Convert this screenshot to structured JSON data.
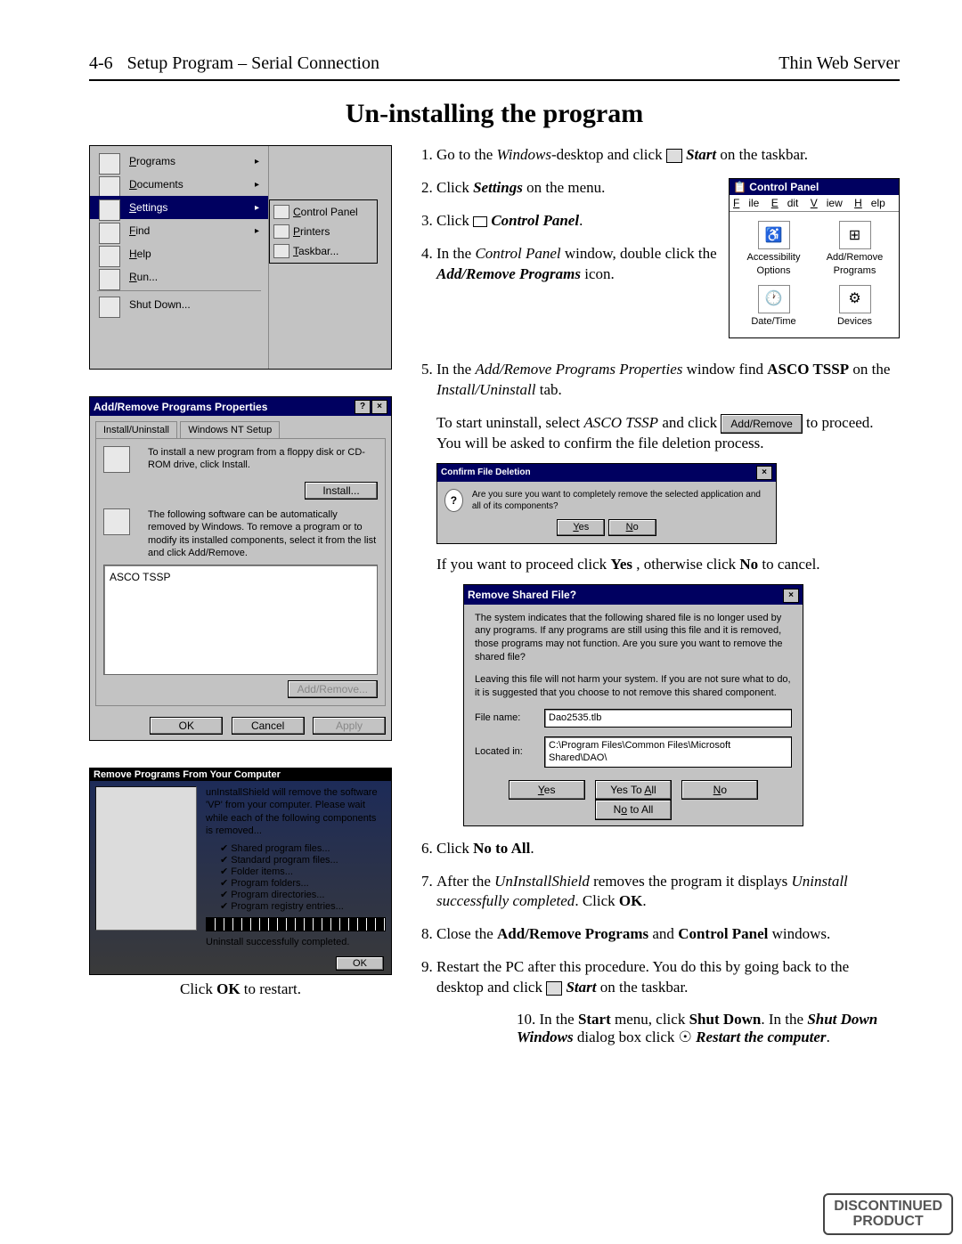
{
  "header": {
    "page_no": "4-6",
    "section": "Setup Program – Serial Connection",
    "doc": "Thin Web Server"
  },
  "title": "Un-installing the program",
  "startmenu": {
    "items": [
      "Programs",
      "Documents",
      "Settings",
      "Find",
      "Help",
      "Run...",
      "Shut Down..."
    ],
    "submenu": [
      "Control Panel",
      "Printers",
      "Taskbar..."
    ]
  },
  "addremove": {
    "title": "Add/Remove Programs Properties",
    "tab1": "Install/Uninstall",
    "tab2": "Windows NT Setup",
    "text1": "To install a new program from a floppy disk or CD-ROM drive, click Install.",
    "install_btn": "Install...",
    "text2": "The following software can be automatically removed by Windows. To remove a program or to modify its installed components, select it from the list and click Add/Remove.",
    "list_item": "ASCO TSSP",
    "addrem_btn": "Add/Remove...",
    "ok": "OK",
    "cancel": "Cancel",
    "apply": "Apply"
  },
  "unshield": {
    "title": "Remove Programs From Your Computer",
    "text": "unInstallShield will remove the software 'VP' from your computer. Please wait while each of the following components is removed...",
    "items": [
      "Shared program files...",
      "Standard program files...",
      "Folder items...",
      "Program folders...",
      "Program directories...",
      "Program registry entries..."
    ],
    "done": "Uninstall successfully completed.",
    "ok": "OK"
  },
  "foot_left": "Click OK to restart.",
  "cp": {
    "title": "Control Panel",
    "menu": [
      "File",
      "Edit",
      "View",
      "Help"
    ],
    "icons": [
      "Accessibility Options",
      "Add/Remove Programs",
      "Date/Time",
      "Devices"
    ]
  },
  "steps": {
    "s1a": "Go to the ",
    "s1b": "Windows",
    "s1c": "-desktop and click ",
    "s1d": "Start",
    "s1e": " on the taskbar.",
    "s2a": "Click ",
    "s2b": "Settings",
    "s2c": " on the menu.",
    "s3a": "Click ",
    "s3b": "Control Panel",
    "s3c": ".",
    "s4a": "In the ",
    "s4b": "Control Panel",
    "s4c": " window, double click the ",
    "s4d": "Add/Remove Programs",
    "s4e": " icon.",
    "s5a": "In the ",
    "s5b": "Add/Remove Programs Properties",
    "s5c": " window find ",
    "s5d": "ASCO TSSP",
    "s5e": " on the ",
    "s5f": "Install/Uninstall",
    "s5g": " tab.",
    "s5p1a": "To start uninstall, select ",
    "s5p1b": "ASCO TSSP",
    "s5p1c": " and click ",
    "s5p1btn": "Add/Remove",
    "s5p1d": " to proceed.  You will be asked to confirm the file deletion process.",
    "s5p2a": "If you want to proceed click ",
    "s5p2b": "Yes",
    "s5p2c": " , otherwise click ",
    "s5p2d": "No",
    "s5p2e": " to cancel.",
    "s6a": "Click ",
    "s6b": "No to All",
    "s6c": ".",
    "s7a": "After the ",
    "s7b": "UnInstallShield",
    "s7c": " removes the program  it displays ",
    "s7d": "Uninstall successfully completed",
    "s7e": ".  Click ",
    "s7f": "OK",
    "s7g": ".",
    "s8a": "Close the ",
    "s8b": "Add/Remove Programs",
    "s8c": " and ",
    "s8d": "Control Panel",
    "s8e": " windows.",
    "s9a": "Restart the PC after this procedure. You do this by going back to the desktop and click ",
    "s9b": "Start",
    "s9c": " on the taskbar.",
    "s10a": "In the ",
    "s10b": "Start",
    "s10c": " menu, click ",
    "s10d": "Shut Down",
    "s10e": ".  In the ",
    "s10f": "Shut Down Windows",
    "s10g": " dialog box click ",
    "s10h": "Restart the computer",
    "s10i": "."
  },
  "confirm": {
    "title": "Confirm File Deletion",
    "msg": "Are you sure you want to completely remove the selected application and all of its components?",
    "yes": "Yes",
    "no": "No"
  },
  "shared": {
    "title": "Remove Shared File?",
    "p1": "The system indicates that the following shared file is no longer used by any programs. If any programs are still using this file and it is removed, those programs may not function. Are you sure you want to remove the shared file?",
    "p2": "Leaving this file will not harm your system. If you are not sure what to do, it is suggested that you choose to not remove this shared component.",
    "fname_label": "File name:",
    "fname": "Dao2535.tlb",
    "loc_label": "Located in:",
    "loc": "C:\\Program Files\\Common Files\\Microsoft Shared\\DAO\\",
    "yes": "Yes",
    "yall": "Yes To All",
    "no": "No",
    "nall": "No to All"
  },
  "stamp": {
    "l1": "DISCONTINUED",
    "l2": "PRODUCT"
  }
}
